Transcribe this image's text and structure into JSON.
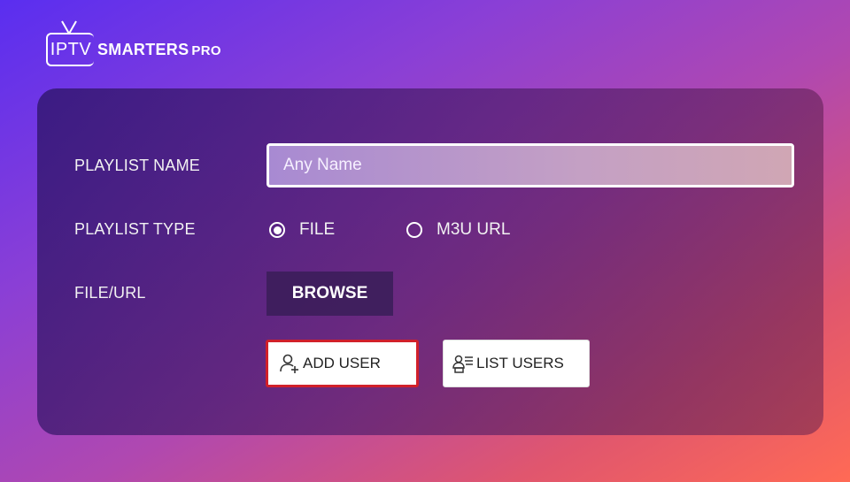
{
  "logo": {
    "iptv": "IPTV",
    "brand": "SMARTERS",
    "suffix": "PRO"
  },
  "form": {
    "playlist_name_label": "PLAYLIST NAME",
    "playlist_name_placeholder": "Any Name",
    "playlist_type_label": "PLAYLIST TYPE",
    "type_options": [
      {
        "label": "FILE",
        "selected": true
      },
      {
        "label": "M3U URL",
        "selected": false
      }
    ],
    "file_url_label": "FILE/URL",
    "browse_label": "BROWSE"
  },
  "actions": {
    "add_user_label": "ADD USER",
    "list_users_label": "LIST USERS"
  },
  "colors": {
    "focus_border": "#d1202a",
    "gradient_start": "#5a2ef0",
    "gradient_end": "#ff6a55"
  }
}
